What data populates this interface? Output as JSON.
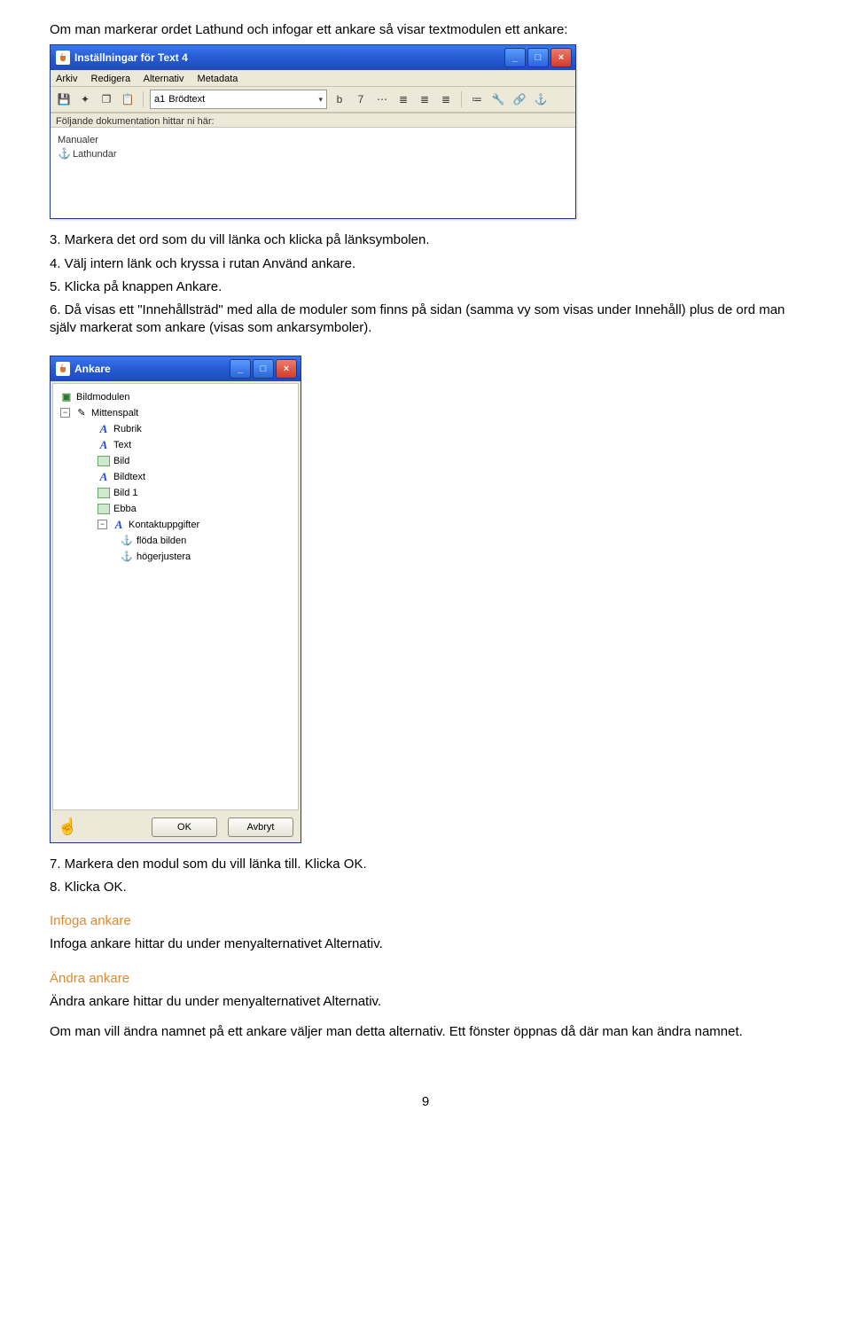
{
  "intro_line": "Om man markerar ordet Lathund och infogar ett ankare så visar textmodulen ett ankare:",
  "window1": {
    "title": "Inställningar för Text 4",
    "min_label": "_",
    "max_label": "□",
    "close_label": "×",
    "menu": {
      "arkiv": "Arkiv",
      "redigera": "Redigera",
      "alternativ": "Alternativ",
      "metadata": "Metadata"
    },
    "toolbar": {
      "save_icon": "💾",
      "add_icon": "✦",
      "copy_icon": "❐",
      "paste_icon": "📋",
      "style_prefix_icon": "a1",
      "style_select": "Brödtext",
      "b": "b",
      "seven": "7",
      "ellipsis": "⋯",
      "align_left": "≣",
      "align_center": "≣",
      "align_right": "≣",
      "list": "≔",
      "wrench": "🔧",
      "link": "🔗",
      "anchor": "⚓"
    },
    "field_label": "Följande dokumentation hittar ni här:",
    "editor_line1": "Manualer",
    "editor_anchor_glyph": "⚓",
    "editor_line2": "Lathundar"
  },
  "steps_mid": {
    "s3": "3. Markera det ord som du vill länka och klicka på länksymbolen.",
    "s4": "4. Välj intern länk och kryssa i rutan Använd ankare.",
    "s5": "5. Klicka på knappen Ankare.",
    "s6": "6. Då visas ett \"Innehållsträd\" med alla de moduler som finns på sidan (samma vy som visas under Innehåll) plus de ord man själv markerat som ankare (visas som ankarsymboler)."
  },
  "window2": {
    "title": "Ankare",
    "min_label": "_",
    "max_label": "□",
    "close_label": "×",
    "tree": {
      "bildmodulen": "Bildmodulen",
      "mittenspalt": "Mittenspalt",
      "rubrik": "Rubrik",
      "text": "Text",
      "bild": "Bild",
      "bildtext": "Bildtext",
      "bild1": "Bild 1",
      "ebba": "Ebba",
      "kontakt": "Kontaktuppgifter",
      "floda": "flöda bilden",
      "hoger": "högerjustera"
    },
    "anchor_glyph": "⚓",
    "toggle_minus": "−",
    "hand_glyph": "☝",
    "ok": "OK",
    "cancel": "Avbryt"
  },
  "steps_after": {
    "s7": "7. Markera den modul som du vill länka till. Klicka OK.",
    "s8": "8. Klicka OK."
  },
  "infoga_heading": "Infoga ankare",
  "infoga_text": "Infoga ankare hittar du under menyalternativet Alternativ.",
  "andra_heading": "Ändra ankare",
  "andra_text": "Ändra ankare hittar du under menyalternativet Alternativ.",
  "final_text": "Om man vill ändra namnet på ett ankare väljer man detta alternativ. Ett fönster öppnas då där man kan ändra namnet.",
  "page_number": "9"
}
